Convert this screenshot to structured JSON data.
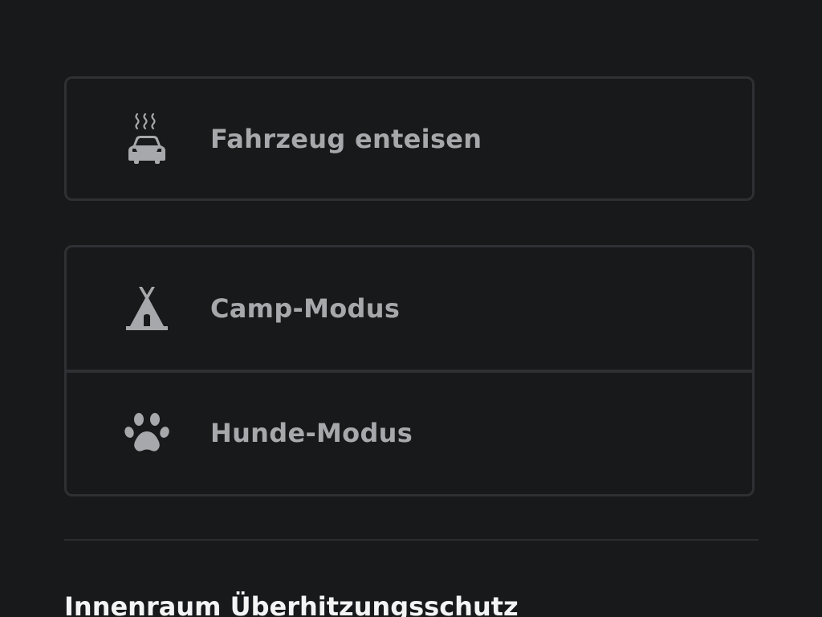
{
  "colors": {
    "background": "#18191b",
    "card_border": "#2f3033",
    "label": "#a7a8ab",
    "icon": "#a7a8ab",
    "heading": "#f4f4f4"
  },
  "controls": {
    "defrost": {
      "label": "Fahrzeug enteisen",
      "icon": "car-heat-icon"
    },
    "camp": {
      "label": "Camp-Modus",
      "icon": "tent-icon"
    },
    "dog": {
      "label": "Hunde-Modus",
      "icon": "paw-icon"
    }
  },
  "overheat_section": {
    "title": "Innenraum Überhitzungsschutz"
  }
}
